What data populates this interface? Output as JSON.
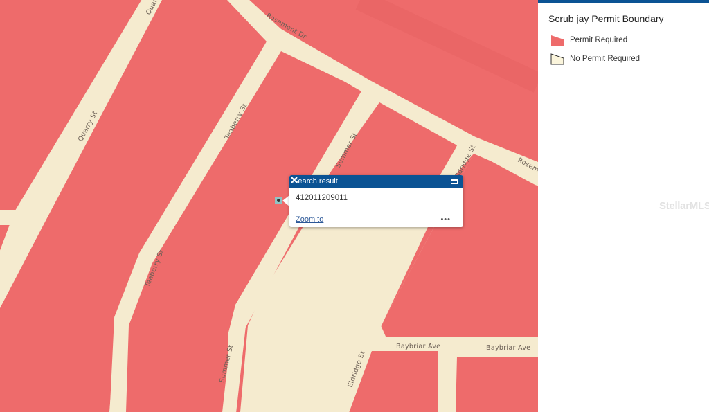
{
  "legend": {
    "title": "Scrub jay Permit Boundary",
    "items": [
      {
        "label": "Permit Required",
        "color": "#ee6b6b"
      },
      {
        "label": "No Permit Required",
        "color": "#fbf5dc"
      }
    ]
  },
  "popup": {
    "title": "Search result",
    "value": "412011209011",
    "zoom_label": "Zoom to",
    "more_label": "•••"
  },
  "streets": {
    "quarry_top": "Quarry",
    "quarry": "Quarry St",
    "rosemont": "Rosemont Dr",
    "rosemont_right": "Rosemo",
    "teaberry_top": "Teaberry St",
    "teaberry_bottom": "Teaberry St",
    "summer_top": "Summer St",
    "summer_bottom": "Summer St",
    "eldridge_top": "Eldridge St",
    "eldridge_bottom": "Eldridge St",
    "baybriar_1": "Baybriar Ave",
    "baybriar_2": "Baybriar Ave"
  },
  "watermark": "StellarMLS",
  "colors": {
    "permit_fill": "#ee6b6b",
    "road": "#f5ebcf",
    "accent": "#0b5394"
  }
}
